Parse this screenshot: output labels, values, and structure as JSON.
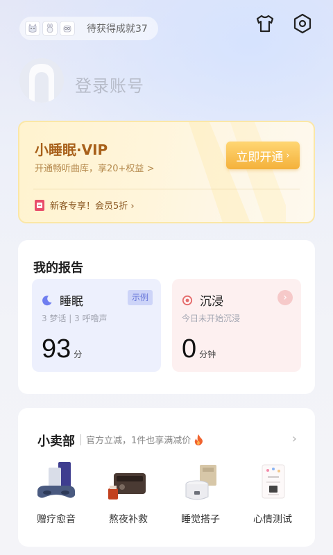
{
  "header": {
    "achievement_text": "待获得成就37",
    "icons": [
      "cat-badge-icon",
      "rabbit-badge-icon",
      "owl-badge-icon",
      "tshirt-icon",
      "settings-icon"
    ]
  },
  "profile": {
    "login_text": "登录账号"
  },
  "vip": {
    "title": "小睡眠·VIP",
    "subtitle": "开通畅听曲库，享20+权益 >",
    "button_label": "立即开通",
    "promo_text": "新客专享！会员5折 ›"
  },
  "report": {
    "title": "我的报告",
    "sleep": {
      "label": "睡眠",
      "tag": "示例",
      "meta": "3 梦话 | 3 呼噜声",
      "score": "93",
      "unit": "分"
    },
    "immerse": {
      "label": "沉浸",
      "meta": "今日未开始沉浸",
      "score": "0",
      "unit": "分钟"
    }
  },
  "shop": {
    "title": "小卖部",
    "subtitle": "官方立减，1件也享满减价",
    "more": "›",
    "items": [
      {
        "label": "赠疗愈音"
      },
      {
        "label": "熬夜补救"
      },
      {
        "label": "睡觉搭子"
      },
      {
        "label": "心情测试"
      }
    ]
  },
  "colors": {
    "vip_title": "#a8601a",
    "vip_button": "#f4b13b",
    "sleep_accent": "#6473d8",
    "immerse_accent": "#e46a6a"
  }
}
